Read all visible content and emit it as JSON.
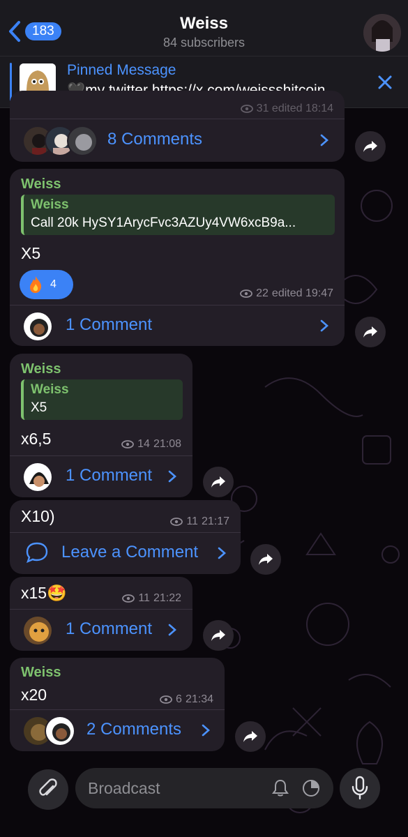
{
  "header": {
    "back_count": "183",
    "title": "Weiss",
    "subtitle": "84 subscribers"
  },
  "pinned": {
    "title": "Pinned Message",
    "text": "🖤my twitter https://x.com/weissshitcoin..."
  },
  "messages": [
    {
      "meta_partial": "31 edited 18:14",
      "comments": "8 Comments"
    },
    {
      "sender": "Weiss",
      "quote_author": "Weiss",
      "quote_text": "Call 20k HySY1ArycFvc3AZUy4VW6xcB9a...",
      "text": "X5",
      "reaction_count": "4",
      "views": "22",
      "time": "edited 19:47",
      "comments": "1 Comment"
    },
    {
      "sender": "Weiss",
      "quote_author": "Weiss",
      "quote_text": "X5",
      "text": "x6,5",
      "views": "14",
      "time": "21:08",
      "comments": "1 Comment"
    },
    {
      "text": "X10)",
      "views": "11",
      "time": "21:17",
      "comments": "Leave a Comment"
    },
    {
      "text": "x15🤩",
      "views": "11",
      "time": "21:22",
      "comments": "1 Comment"
    },
    {
      "sender": "Weiss",
      "text": "x20",
      "views": "6",
      "time": "21:34",
      "comments": "2 Comments"
    }
  ],
  "composer": {
    "placeholder": "Broadcast"
  },
  "colors": {
    "accent": "#3b82f6",
    "link": "#4c93ff",
    "sender": "#7ec26e",
    "bubble": "#231e27"
  }
}
